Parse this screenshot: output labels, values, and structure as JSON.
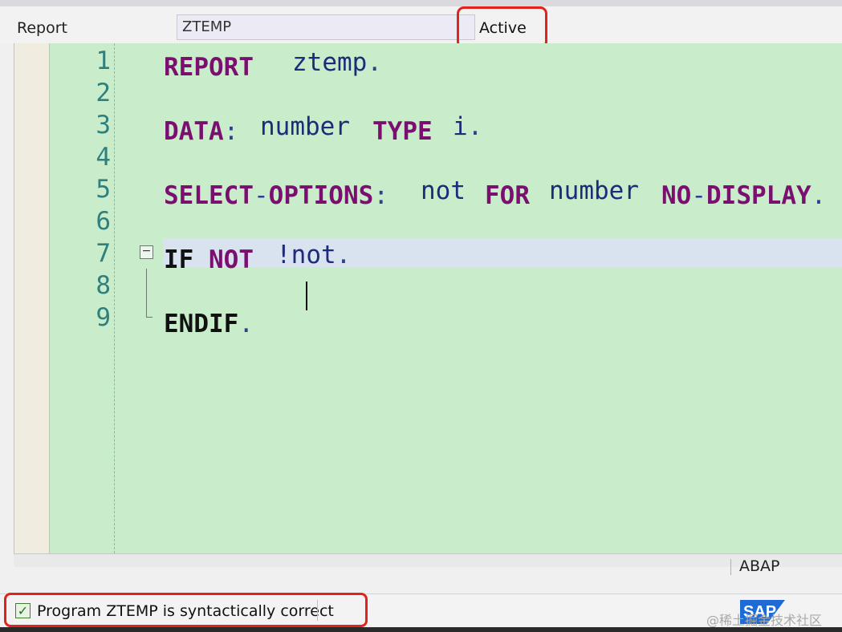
{
  "header": {
    "object_type_label": "Report",
    "object_name": "ZTEMP",
    "status": "Active"
  },
  "editor": {
    "line_numbers": [
      "1",
      "2",
      "3",
      "4",
      "5",
      "6",
      "7",
      "8",
      "9"
    ],
    "lines": {
      "l1": {
        "kw": "REPORT",
        "id": "ztemp",
        "end": "."
      },
      "l3": {
        "kw": "DATA",
        "colon": ":",
        "id1": "number",
        "kw2": "TYPE",
        "id2": "i",
        "end": "."
      },
      "l5": {
        "kw_a": "SELECT",
        "dash": "-",
        "kw_b": "OPTIONS",
        "colon": ":",
        "id1": "not",
        "kw2": "FOR",
        "id2": "number",
        "kw3_a": "NO",
        "dash2": "-",
        "kw3_b": "DISPLAY",
        "end": "."
      },
      "l7": {
        "kw_a": "IF",
        "kw_b": "NOT",
        "id": "!not",
        "end": "."
      },
      "l9": {
        "kw": "ENDIF",
        "end": "."
      }
    },
    "language": "ABAP"
  },
  "statusbar": {
    "message": "Program ZTEMP is syntactically correct"
  },
  "branding": {
    "logo": "SAP",
    "watermark": "@稀土掘金技术社区"
  },
  "colors": {
    "editor_bg": "#c9edcb",
    "keyword": "#7a0f6f",
    "identifier": "#1f2a7a",
    "line_number": "#2f7f7f",
    "highlight": "#e0241c"
  }
}
